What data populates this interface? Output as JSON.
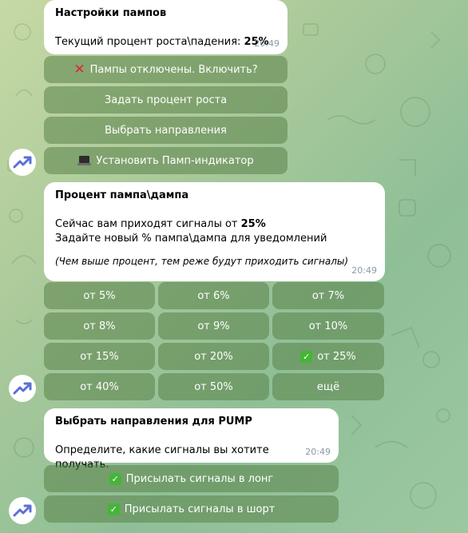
{
  "messages": [
    {
      "title": "Настройки пампов",
      "text_prefix": "Текущий процент роста\\падения: ",
      "text_value": "25%",
      "time": "20:49",
      "buttons": [
        {
          "icon": "red-x-icon",
          "label": "Пампы отключены. Включить?"
        },
        {
          "label": "Задать процент роста"
        },
        {
          "label": "Выбрать направления"
        },
        {
          "icon": "laptop-icon",
          "label": "Установить Памп-индикатор"
        }
      ]
    },
    {
      "title": "Процент пампа\\дампа",
      "line1_prefix": "Сейчас вам приходят сигналы от ",
      "line1_value": "25%",
      "line2": "Задайте новый % пампа\\дампа для уведомлений",
      "note": "(Чем выше процент, тем реже будут приходить сигналы)",
      "time": "20:49",
      "grid": [
        [
          "от 5%",
          "от 6%",
          "от 7%"
        ],
        [
          "от 8%",
          "от 9%",
          "от 10%"
        ],
        [
          "от 15%",
          "от 20%",
          "от 25%"
        ],
        [
          "от 40%",
          "от 50%",
          "ещё"
        ]
      ],
      "selected_option": "от 25%"
    },
    {
      "title": "Выбрать направления для PUMP",
      "text": "Определите, какие сигналы вы хотите получать.",
      "time": "20:49",
      "buttons": [
        {
          "icon": "check-icon",
          "label": "Присылать сигналы в лонг"
        },
        {
          "icon": "check-icon",
          "label": "Присылать сигналы в шорт"
        }
      ]
    }
  ],
  "colors": {
    "bubble": "#ffffff",
    "button": "#5a8248",
    "avatar_arrow": "#5b6fd6",
    "check": "#45b537",
    "red_x": "#e0242f"
  }
}
